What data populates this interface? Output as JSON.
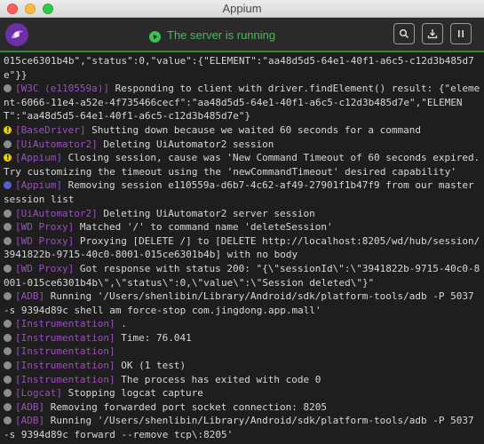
{
  "window": {
    "title": "Appium"
  },
  "header": {
    "status_text": "The server is running",
    "status_color": "#3fbf54",
    "buttons": [
      {
        "name": "search-icon"
      },
      {
        "name": "download-icon"
      },
      {
        "name": "pause-icon"
      }
    ]
  },
  "colors": {
    "tag": "#9b4fbf",
    "text": "#d8d8d8",
    "background": "#1e1e1e",
    "accent": "#2f8a3c"
  },
  "log": [
    {
      "level": "none",
      "tag": "",
      "text": "015ce6301b4b\",\"status\":0,\"value\":{\"ELEMENT\":\"aa48d5d5-64e1-40f1-a6c5-c12d3b485d7e\"}}"
    },
    {
      "level": "debug",
      "tag": "[W3C (e110559a)]",
      "text": " Responding to client with driver.findElement() result: {\"element-6066-11e4-a52e-4f735466cecf\":\"aa48d5d5-64e1-40f1-a6c5-c12d3b485d7e\",\"ELEMENT\":\"aa48d5d5-64e1-40f1-a6c5-c12d3b485d7e\"}"
    },
    {
      "level": "warn",
      "tag": "[BaseDriver]",
      "text": " Shutting down because we waited 60 seconds for a command"
    },
    {
      "level": "debug",
      "tag": "[UiAutomator2]",
      "text": " Deleting UiAutomator2 session"
    },
    {
      "level": "warn",
      "tag": "[Appium]",
      "text": " Closing session, cause was 'New Command Timeout of 60 seconds expired. Try customizing the timeout using the 'newCommandTimeout' desired capability'"
    },
    {
      "level": "info",
      "tag": "[Appium]",
      "text": " Removing session e110559a-d6b7-4c62-af49-27901f1b47f9 from our master session list"
    },
    {
      "level": "debug",
      "tag": "[UiAutomator2]",
      "text": " Deleting UiAutomator2 server session"
    },
    {
      "level": "debug",
      "tag": "[WD Proxy]",
      "text": " Matched '/' to command name 'deleteSession'"
    },
    {
      "level": "debug",
      "tag": "[WD Proxy]",
      "text": " Proxying [DELETE /] to [DELETE http://localhost:8205/wd/hub/session/3941822b-9715-40c0-8001-015ce6301b4b] with no body"
    },
    {
      "level": "debug",
      "tag": "[WD Proxy]",
      "text": " Got response with status 200: \"{\\\"sessionId\\\":\\\"3941822b-9715-40c0-8001-015ce6301b4b\\\",\\\"status\\\":0,\\\"value\\\":\\\"Session deleted\\\"}\""
    },
    {
      "level": "debug",
      "tag": "[ADB]",
      "text": " Running '/Users/shenlibin/Library/Android/sdk/platform-tools/adb -P 5037 -s 9394d89c shell am force-stop com.jingdong.app.mall'"
    },
    {
      "level": "debug",
      "tag": "[Instrumentation]",
      "text": " ."
    },
    {
      "level": "debug",
      "tag": "[Instrumentation]",
      "text": " Time: 76.041"
    },
    {
      "level": "debug",
      "tag": "[Instrumentation]",
      "text": ""
    },
    {
      "level": "debug",
      "tag": "[Instrumentation]",
      "text": " OK (1 test)"
    },
    {
      "level": "debug",
      "tag": "[Instrumentation]",
      "text": " The process has exited with code 0"
    },
    {
      "level": "debug",
      "tag": "[Logcat]",
      "text": " Stopping logcat capture"
    },
    {
      "level": "debug",
      "tag": "[ADB]",
      "text": " Removing forwarded port socket connection: 8205"
    },
    {
      "level": "debug",
      "tag": "[ADB]",
      "text": " Running '/Users/shenlibin/Library/Android/sdk/platform-tools/adb -P 5037 -s 9394d89c forward --remove tcp\\:8205'"
    }
  ]
}
